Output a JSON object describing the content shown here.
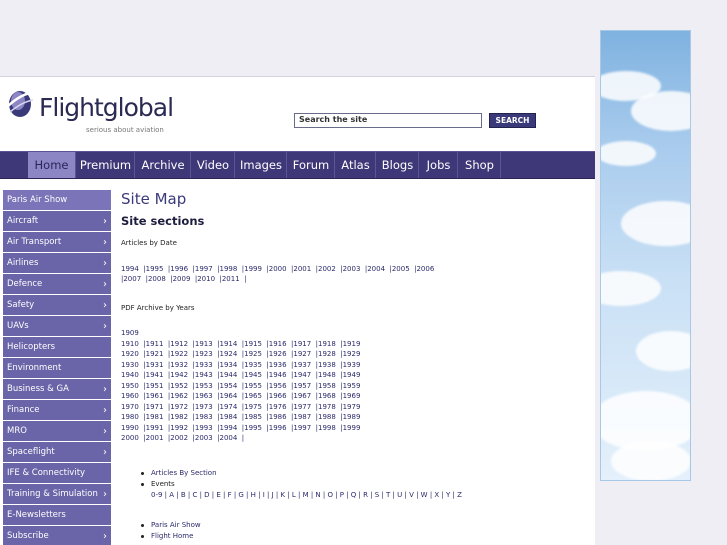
{
  "header": {
    "logo_text": "Flightglobal",
    "logo_tagline": "serious about aviation",
    "search_placeholder": "Search the site",
    "search_button": "SEARCH"
  },
  "nav": {
    "items": [
      "Home",
      "Premium",
      "Archive",
      "Video",
      "Images",
      "Forum",
      "Atlas",
      "Blogs",
      "Jobs",
      "Shop"
    ],
    "active": "Home"
  },
  "sidebar": {
    "items": [
      {
        "label": "Paris Air Show",
        "chevron": false
      },
      {
        "label": "Aircraft",
        "chevron": true
      },
      {
        "label": "Air Transport",
        "chevron": true
      },
      {
        "label": "Airlines",
        "chevron": true
      },
      {
        "label": "Defence",
        "chevron": true
      },
      {
        "label": "Safety",
        "chevron": true
      },
      {
        "label": "UAVs",
        "chevron": true
      },
      {
        "label": "Helicopters",
        "chevron": false
      },
      {
        "label": "Environment",
        "chevron": false
      },
      {
        "label": "Business & GA",
        "chevron": true
      },
      {
        "label": "Finance",
        "chevron": true
      },
      {
        "label": "MRO",
        "chevron": true
      },
      {
        "label": "Spaceflight",
        "chevron": true
      },
      {
        "label": "IFE & Connectivity",
        "chevron": false
      },
      {
        "label": "Training & Simulation",
        "chevron": true
      },
      {
        "label": "E-Newsletters",
        "chevron": false
      },
      {
        "label": "Subscribe",
        "chevron": true
      }
    ],
    "chevron_glyph": "›"
  },
  "main": {
    "page_title": "Site Map",
    "section_title": "Site sections",
    "articles_by_date_label": "Articles by Date",
    "articles_years_line1": "1994  |1995  |1996  |1997  |1998  |1999  |2000  |2001  |2002  |2003  |2004  |2005  |2006",
    "articles_years_line2": "|2007  |2008  |2009  |2010  |2011  |",
    "pdf_archive_label": "PDF Archive by Years",
    "pdf_years": [
      "1909",
      "1910  |1911  |1912  |1913  |1914  |1915  |1916  |1917  |1918  |1919",
      "1920  |1921  |1922  |1923  |1924  |1925  |1926  |1927  |1928  |1929",
      "1930  |1931  |1932  |1933  |1934  |1935  |1936  |1937  |1938  |1939",
      "1940  |1941  |1942  |1943  |1944  |1945  |1946  |1947  |1948  |1949",
      "1950  |1951  |1952  |1953  |1954  |1955  |1956  |1957  |1958  |1959",
      "1960  |1961  |1962  |1963  |1964  |1965  |1966  |1967  |1968  |1969",
      "1970  |1971  |1972  |1973  |1974  |1975  |1976  |1977  |1978  |1979",
      "1980  |1981  |1982  |1983  |1984  |1985  |1986  |1987  |1988  |1989",
      "1990  |1991  |1992  |1993  |1994  |1995  |1996  |1997  |1998  |1999",
      "2000  |2001  |2002  |2003  |2004  |"
    ],
    "articles_by_section": "Articles By Section",
    "events": "Events",
    "alpha_index": "0-9 | A | B | C | D | E | F | G | H | I | J | K | L | M | N | O | P | Q | R | S | T | U | V | W | X | Y | Z",
    "paris_air_show": "Paris Air Show",
    "flight_home": "Flight Home"
  },
  "colors": {
    "nav_bg": "#3f3878",
    "nav_active": "#8c86c4",
    "sidebar_bg": "#6a64a8",
    "title": "#3a3a7a"
  }
}
